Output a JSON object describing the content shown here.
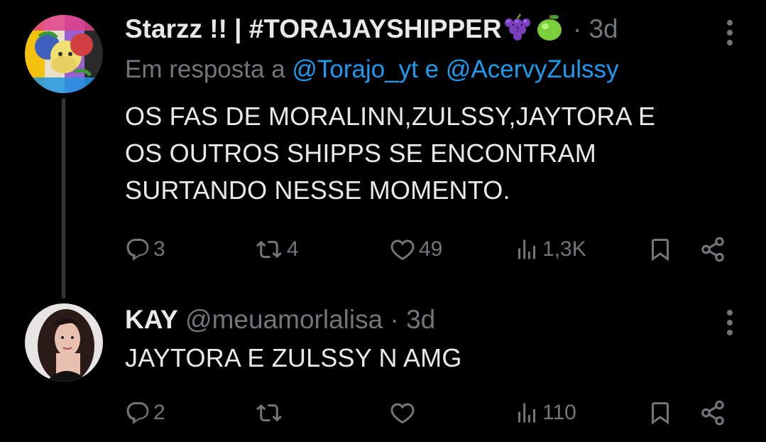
{
  "tweets": [
    {
      "name": "Starzz !! | #TORAJAYSHIPPER",
      "name_emojis": [
        "grapes-emoji",
        "green-apple-emoji"
      ],
      "dot": "·",
      "time": "3d",
      "replying_prefix": "Em resposta a",
      "mention1": "@Torajo_yt",
      "replying_conj": "e",
      "mention2": "@AcervyZulssy",
      "text_lines": [
        "OS FAS DE MORALINN,ZULSSY,JAYTORA E",
        "OS OUTROS SHIPPS SE ENCONTRAM",
        "SURTANDO NESSE MOMENTO."
      ],
      "replies": "3",
      "retweets": "4",
      "likes": "49",
      "views": "1,3K"
    },
    {
      "name": "KAY",
      "handle": "@meuamorlalisa",
      "dot": "·",
      "time": "3d",
      "text_lines": [
        "JAYTORA E ZULSSY N AMG"
      ],
      "replies": "2",
      "retweets": "",
      "likes": "",
      "views": "110"
    }
  ],
  "colors": {
    "background": "#000000",
    "text": "#e7e9ea",
    "secondary": "#71767b",
    "link": "#1d9bf0"
  }
}
